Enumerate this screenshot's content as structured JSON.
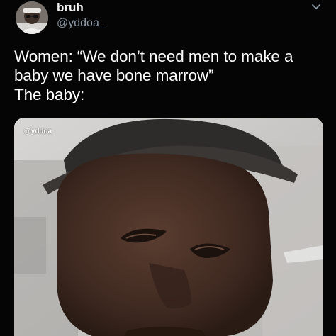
{
  "author": {
    "display_name": "bruh",
    "handle": "@yddoa_"
  },
  "tweet": {
    "lines": [
      "Women: “We don’t need men to make a",
      "baby we have bone marrow”",
      "The baby:"
    ]
  },
  "media": {
    "watermark": "@yddoa"
  },
  "icons": {
    "menu": "chevron-down-icon"
  },
  "colors": {
    "background": "#000000",
    "handle": "#8b98a5",
    "text": "#ffffff"
  }
}
